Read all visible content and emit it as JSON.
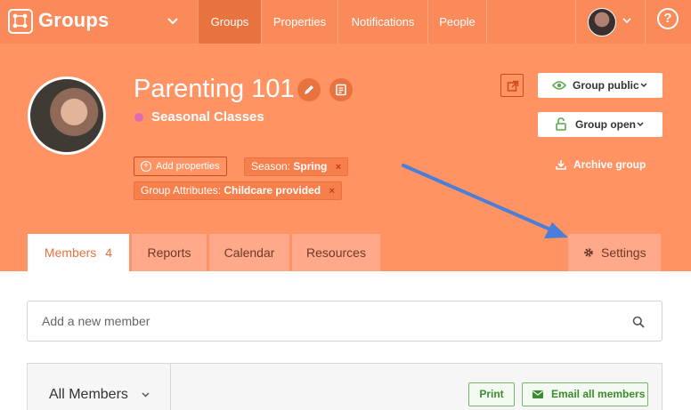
{
  "nav": {
    "brand": "Groups",
    "tabs": [
      {
        "label": "Groups",
        "active": true
      },
      {
        "label": "Properties",
        "active": false
      },
      {
        "label": "Notifications",
        "active": false
      },
      {
        "label": "People",
        "active": false
      }
    ],
    "help_glyph": "?"
  },
  "group": {
    "title": "Parenting 101",
    "subtitle": "Seasonal Classes",
    "subtitle_dot_color": "#e06cb0",
    "add_properties_label": "Add properties",
    "tags": [
      {
        "key": "Season:",
        "value": "Spring"
      },
      {
        "key": "Group Attributes:",
        "value": "Childcare provided"
      }
    ],
    "remove_glyph": "×"
  },
  "actions": {
    "public_label": "Group public",
    "open_label": "Group open",
    "archive_label": "Archive group"
  },
  "tabs": {
    "members_label": "Members",
    "members_count": "4",
    "reports_label": "Reports",
    "calendar_label": "Calendar",
    "resources_label": "Resources",
    "settings_label": "Settings"
  },
  "members": {
    "search_placeholder": "Add a new member",
    "filter_label": "All Members",
    "print_label": "Print",
    "email_label": "Email all members"
  },
  "colors": {
    "nav_bg": "#fa8a5a",
    "nav_active": "#e8733f",
    "header_bg": "#ff9363",
    "tab_bg": "#ffa98a",
    "accent": "#e8733f",
    "annotation_arrow": "#4a7fd9",
    "green": "#3e8a2f"
  }
}
